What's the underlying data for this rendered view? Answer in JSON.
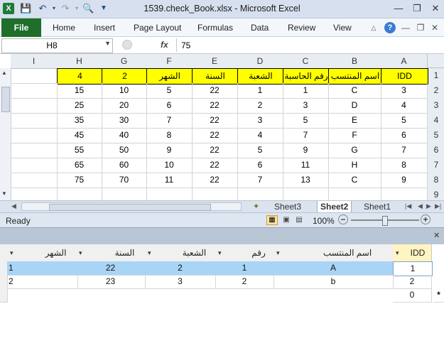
{
  "window": {
    "title": "1539.check_Book.xlsx  -  Microsoft Excel",
    "qat_icons": [
      "excel-logo-icon",
      "save-icon",
      "undo-icon",
      "redo-icon",
      "print-preview-icon",
      "customize-icon"
    ],
    "controls": [
      "minimize-icon",
      "maximize-icon",
      "close-icon"
    ]
  },
  "ribbon": {
    "file_label": "File",
    "tabs": [
      "Home",
      "Insert",
      "Page Layout",
      "Formulas",
      "Data",
      "Review",
      "View"
    ],
    "icons": [
      "ribbon-minimize-icon",
      "help-icon",
      "doc-minimize-icon",
      "doc-restore-icon",
      "doc-close-icon"
    ]
  },
  "formula_bar": {
    "name_box": "H8",
    "fx_label": "fx",
    "value": "75"
  },
  "grid": {
    "columns": [
      "I",
      "H",
      "G",
      "F",
      "E",
      "D",
      "C",
      "B",
      "A"
    ],
    "rows": [
      "1",
      "2",
      "3",
      "4",
      "5",
      "6",
      "7",
      "8",
      "9"
    ],
    "header_row": [
      "",
      "4",
      "2",
      "الشهر",
      "السنة",
      "الشعبة",
      "رقم الحاسبة",
      "اسم المنتسب",
      "IDD"
    ],
    "data_rows": [
      [
        "",
        "15",
        "10",
        "5",
        "22",
        "1",
        "1",
        "C",
        "3"
      ],
      [
        "",
        "25",
        "20",
        "6",
        "22",
        "2",
        "3",
        "D",
        "4"
      ],
      [
        "",
        "35",
        "30",
        "7",
        "22",
        "3",
        "5",
        "E",
        "5"
      ],
      [
        "",
        "45",
        "40",
        "8",
        "22",
        "4",
        "7",
        "F",
        "6"
      ],
      [
        "",
        "55",
        "50",
        "9",
        "22",
        "5",
        "9",
        "G",
        "7"
      ],
      [
        "",
        "65",
        "60",
        "10",
        "22",
        "6",
        "11",
        "H",
        "8"
      ],
      [
        "",
        "75",
        "70",
        "11",
        "22",
        "7",
        "13",
        "C",
        "9"
      ]
    ]
  },
  "sheets": {
    "tabs": [
      "Sheet3",
      "Sheet2",
      "Sheet1"
    ],
    "active": "Sheet2"
  },
  "status": {
    "ready": "Ready",
    "zoom": "100%"
  },
  "datagrid": {
    "columns": [
      "الشهر",
      "السنة",
      "الشعبة",
      "رقم الحاسبة",
      "اسم المنتسب",
      "IDD"
    ],
    "rows": [
      [
        "1",
        "22",
        "2",
        "1",
        "A",
        "1"
      ],
      [
        "2",
        "23",
        "3",
        "2",
        "b",
        "2"
      ],
      [
        "",
        "",
        "",
        "",
        "",
        "0"
      ]
    ],
    "new_row_marker": "*"
  }
}
